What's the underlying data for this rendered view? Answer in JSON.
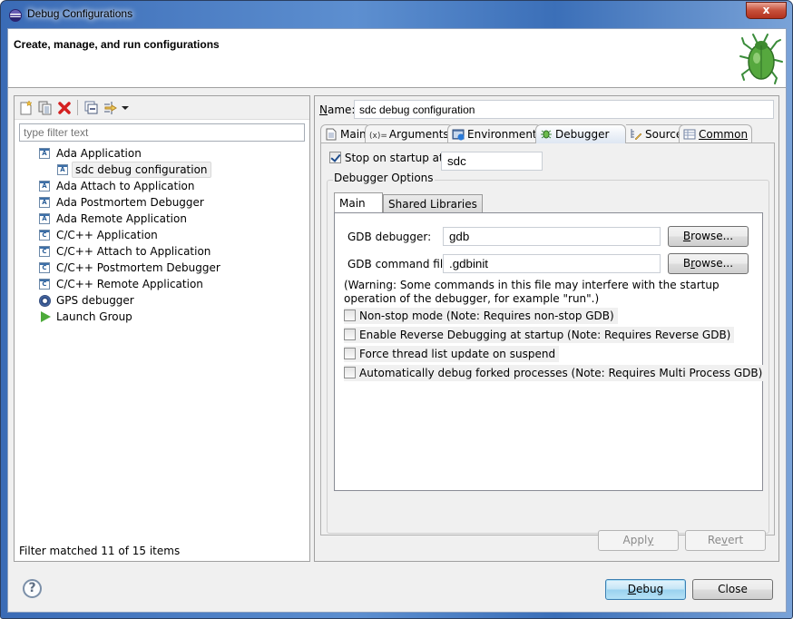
{
  "window": {
    "title": "Debug Configurations",
    "close_label": "x"
  },
  "header": {
    "title": "Create, manage, and run configurations",
    "icon": "bug-icon"
  },
  "left_panel": {
    "toolbar": [
      {
        "name": "new-launch-configuration-icon",
        "tooltip": "New launch configuration"
      },
      {
        "name": "duplicate-icon",
        "tooltip": "Duplicate"
      },
      {
        "name": "delete-icon",
        "tooltip": "Delete"
      },
      {
        "name": "collapse-all-icon",
        "tooltip": "Collapse All"
      },
      {
        "name": "filter-icon",
        "tooltip": "Filter"
      },
      {
        "name": "dropdown-arrow-icon",
        "tooltip": "View menu"
      }
    ],
    "filter_placeholder": "type filter text",
    "tree": [
      {
        "label": "Ada Application",
        "icon": "ada-icon",
        "icon_text": "A",
        "level": 0
      },
      {
        "label": "sdc debug configuration",
        "icon": "ada-icon",
        "icon_text": "A",
        "level": 1,
        "selected": true
      },
      {
        "label": "Ada Attach to Application",
        "icon": "ada-icon",
        "icon_text": "A",
        "level": 0
      },
      {
        "label": "Ada Postmortem Debugger",
        "icon": "ada-icon",
        "icon_text": "A",
        "level": 0
      },
      {
        "label": "Ada Remote Application",
        "icon": "ada-icon",
        "icon_text": "A",
        "level": 0
      },
      {
        "label": "C/C++ Application",
        "icon": "c-icon",
        "icon_text": "C",
        "level": 0
      },
      {
        "label": "C/C++ Attach to Application",
        "icon": "c-icon",
        "icon_text": "C",
        "level": 0
      },
      {
        "label": "C/C++ Postmortem Debugger",
        "icon": "c-icon",
        "icon_text": "C",
        "level": 0
      },
      {
        "label": "C/C++ Remote Application",
        "icon": "c-icon",
        "icon_text": "C",
        "level": 0
      },
      {
        "label": "GPS debugger",
        "icon": "gps-icon",
        "icon_text": "",
        "level": 0
      },
      {
        "label": "Launch Group",
        "icon": "play-icon",
        "icon_text": "",
        "level": 0
      }
    ],
    "status": "Filter matched 11 of 15 items"
  },
  "right_panel": {
    "name_label": "Name:",
    "name_value": "sdc debug configuration",
    "tabs": [
      {
        "label": "Main",
        "icon": "document-icon"
      },
      {
        "label": "Arguments",
        "icon": "variables-icon",
        "icon_text": "(x)="
      },
      {
        "label": "Environment",
        "icon": "environment-icon"
      },
      {
        "label": "Debugger",
        "icon": "bug-icon",
        "active": true
      },
      {
        "label": "Source",
        "icon": "source-icon"
      },
      {
        "label": "Common",
        "icon": "common-icon"
      }
    ],
    "stop_on_startup": {
      "label": "Stop on startup at:",
      "checked": true,
      "value": "sdc"
    },
    "debugger_options": {
      "label": "Debugger Options",
      "tabs": [
        {
          "label": "Main",
          "active": true
        },
        {
          "label": "Shared Libraries"
        }
      ],
      "gdb_debugger": {
        "label": "GDB debugger:",
        "value": "gdb",
        "browse": "Browse..."
      },
      "gdb_command_file": {
        "label": "GDB command file:",
        "value": ".gdbinit",
        "browse": "Browse..."
      },
      "warning": "(Warning: Some commands in this file may interfere with the startup operation of the debugger, for example \"run\".)",
      "options": [
        {
          "label": "Non-stop mode (Note: Requires non-stop GDB)",
          "checked": false
        },
        {
          "label": "Enable Reverse Debugging at startup (Note: Requires Reverse GDB)",
          "checked": false
        },
        {
          "label": "Force thread list update on suspend",
          "checked": false
        },
        {
          "label": "Automatically debug forked processes (Note: Requires Multi Process GDB)",
          "checked": false
        }
      ]
    },
    "apply_label": "Apply",
    "revert_label": "Revert"
  },
  "footer": {
    "help_icon": "?",
    "debug_label": "Debug",
    "close_label": "Close"
  }
}
